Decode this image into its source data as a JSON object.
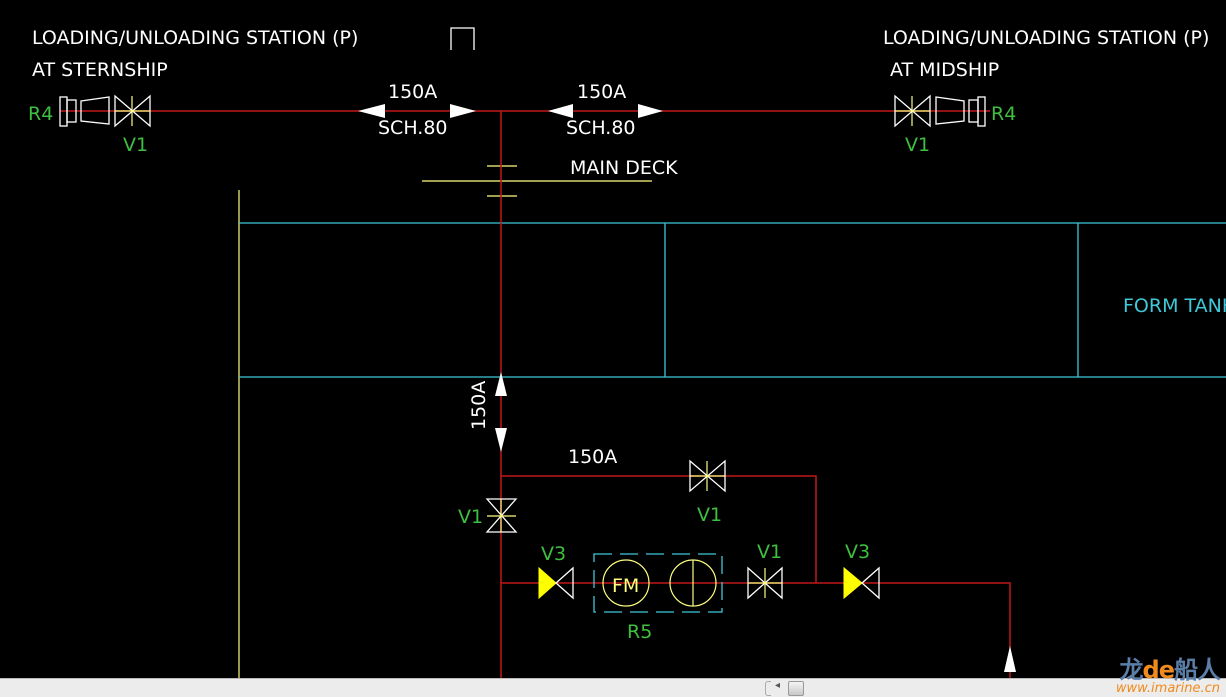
{
  "drawing": {
    "station_left": {
      "title": "LOADING/UNLOADING STATION (P)",
      "subtitle": "AT STERNSHIP",
      "reducer_label": "R4",
      "valve_label": "V1"
    },
    "station_right": {
      "title": "LOADING/UNLOADING STATION (P)",
      "subtitle": "AT MIDSHIP",
      "reducer_label": "R4",
      "valve_label": "V1"
    },
    "pipe_spec_left": {
      "size": "150A",
      "schedule": "SCH.80"
    },
    "pipe_spec_right": {
      "size": "150A",
      "schedule": "SCH.80"
    },
    "deck_label": "MAIN DECK",
    "tank_label": "FORM TANK",
    "vertical_pipe_size": "150A",
    "branch_pipe_size": "150A",
    "valves": {
      "vertical_valve": "V1",
      "bypass_valve": "V1",
      "meter_inlet_valve": "V3",
      "meter_outlet_valve": "V1",
      "outlet_valve": "V3"
    },
    "flowmeter": {
      "label": "FM",
      "assembly_label": "R5"
    }
  },
  "colors": {
    "pipe": "#c01818",
    "label": "#3fbf3f",
    "hull": "#3ec8d8",
    "valve_fill": "#ffff00",
    "background": "#000000"
  },
  "watermark": {
    "brand": "龙de船人",
    "url": "www.imarine.cn"
  }
}
